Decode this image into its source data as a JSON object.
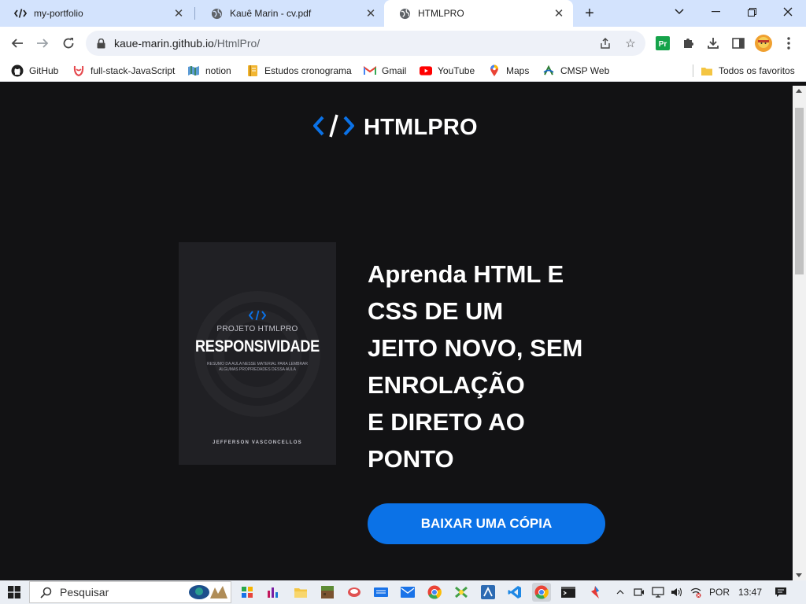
{
  "browser": {
    "tabs": [
      {
        "title": "my-portfolio",
        "icon": "code-icon",
        "active": false
      },
      {
        "title": "Kauê Marin - cv.pdf",
        "icon": "globe-icon",
        "active": false
      },
      {
        "title": "HTMLPRO",
        "icon": "globe-icon",
        "active": true
      }
    ],
    "new_tab": "+",
    "url_host": "kaue-marin.github.io",
    "url_path": "/HtmlPro/",
    "bookmarks": [
      {
        "label": "GitHub",
        "icon": "github-icon"
      },
      {
        "label": "full-stack-JavaScript",
        "icon": "trybe-icon"
      },
      {
        "label": "notion",
        "icon": "map-icon"
      },
      {
        "label": "Estudos cronograma",
        "icon": "notebook-icon"
      },
      {
        "label": "Gmail",
        "icon": "gmail-icon"
      },
      {
        "label": "YouTube",
        "icon": "youtube-icon"
      },
      {
        "label": "Maps",
        "icon": "maps-icon"
      },
      {
        "label": "CMSP Web",
        "icon": "cmsp-icon"
      }
    ],
    "all_bookmarks": "Todos os favoritos"
  },
  "page": {
    "logo_text": "HTMLPRO",
    "book": {
      "subtitle": "PROJETO HTMLPRO",
      "title": "RESPONSIVIDADE",
      "description": "RESUMO DA AULA NESSE MATERIAL PARA LEMBRAR ALGUMAS PROPRIEDADES DESSA AULA",
      "author": "JEFFERSON VASCONCELLOS"
    },
    "headline": [
      "Aprenda HTML E",
      "CSS DE UM",
      "JEITO NOVO, SEM",
      "ENROLAÇÃO",
      "E DIRETO AO",
      "PONTO"
    ],
    "cta": "BAIXAR UMA CÓPIA"
  },
  "taskbar": {
    "search_placeholder": "Pesquisar",
    "language": "POR",
    "time": "13:47"
  },
  "colors": {
    "page_bg": "#121214",
    "accent": "#0b72e7",
    "tab_strip": "#d3e3fd"
  }
}
